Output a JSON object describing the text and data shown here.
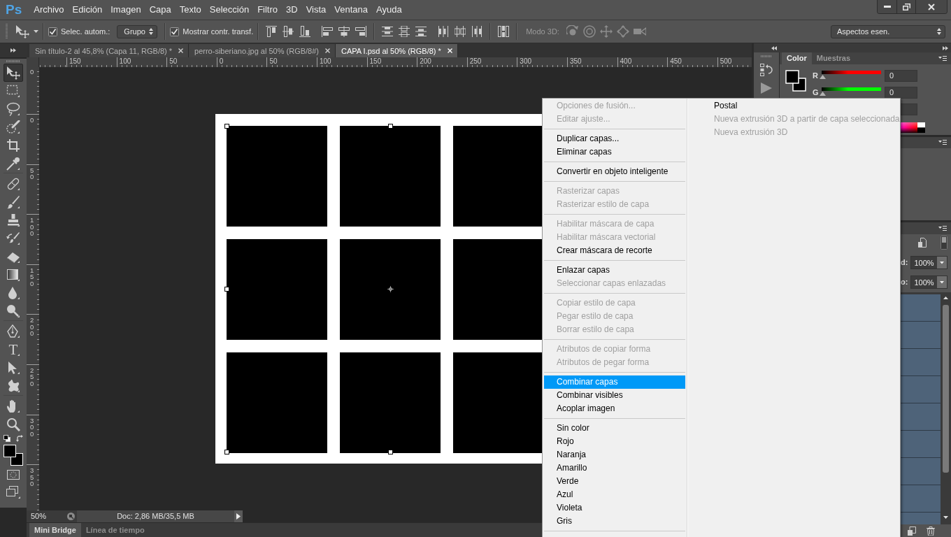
{
  "app": {
    "logo": "Ps"
  },
  "menubar": {
    "items": [
      "Archivo",
      "Edición",
      "Imagen",
      "Capa",
      "Texto",
      "Selección",
      "Filtro",
      "3D",
      "Vista",
      "Ventana",
      "Ayuda"
    ]
  },
  "options_bar": {
    "auto_select": {
      "label": "Selec. autom.:",
      "checked": true
    },
    "auto_select_target": "Grupo",
    "show_transform": {
      "label": "Mostrar contr. transf.",
      "checked": true
    },
    "mode_3d_label": "Modo 3D:",
    "workspace": "Aspectos esen."
  },
  "document_tabs": [
    {
      "label": "Sin título-2 al 45,8% (Capa 11, RGB/8) *",
      "selected": false
    },
    {
      "label": "perro-siberiano.jpg al 50% (RGB/8#)",
      "selected": false
    },
    {
      "label": "CAPA I.psd al 50% (RGB/8) *",
      "selected": true
    }
  ],
  "tool_groups": [
    {
      "tools": [
        {
          "kind": "move",
          "selected": true
        },
        {
          "kind": "marquee",
          "selected": false
        },
        {
          "kind": "lasso",
          "selected": false
        },
        {
          "kind": "quickselect",
          "selected": false
        },
        {
          "kind": "crop",
          "selected": false
        },
        {
          "kind": "eyedropper",
          "selected": false
        }
      ]
    },
    {
      "tools": [
        {
          "kind": "healing",
          "selected": false
        },
        {
          "kind": "brush",
          "selected": false
        },
        {
          "kind": "stamp",
          "selected": false
        },
        {
          "kind": "historybrush",
          "selected": false
        },
        {
          "kind": "eraser",
          "selected": false
        },
        {
          "kind": "gradient",
          "selected": false
        },
        {
          "kind": "blur",
          "selected": false
        },
        {
          "kind": "dodge",
          "selected": false
        }
      ]
    },
    {
      "tools": [
        {
          "kind": "pen",
          "selected": false
        },
        {
          "kind": "type",
          "glyph": "T",
          "selected": false
        },
        {
          "kind": "pathselect",
          "selected": false
        },
        {
          "kind": "shape",
          "selected": false
        }
      ]
    },
    {
      "tools": [
        {
          "kind": "hand",
          "selected": false
        },
        {
          "kind": "zoom",
          "selected": false
        }
      ]
    }
  ],
  "rulers": {
    "horizontal": [
      "150",
      "100",
      "50",
      "0",
      "50",
      "100",
      "150",
      "200",
      "250",
      "300",
      "350",
      "400",
      "450",
      "500"
    ],
    "vertical": [
      "0",
      "0",
      "50",
      "100",
      "150",
      "200",
      "250",
      "300",
      "350"
    ]
  },
  "status_bar": {
    "zoom": "50%",
    "doc_info": "Doc: 2,86 MB/35,5 MB"
  },
  "bottom_tabs": [
    {
      "label": "Mini Bridge",
      "selected": true
    },
    {
      "label": "Línea de tiempo",
      "selected": false
    }
  ],
  "color_panel": {
    "tabs": [
      {
        "label": "Color",
        "selected": true
      },
      {
        "label": "Muestras",
        "selected": false
      }
    ],
    "channels": [
      {
        "label": "R",
        "level": 0,
        "value": "0",
        "color": "#ff0000"
      },
      {
        "label": "G",
        "level": 0,
        "value": "0",
        "color": "#00ff00"
      }
    ]
  },
  "layers_panel": {
    "fields": [
      {
        "label": "d:",
        "value": "100%"
      },
      {
        "label": "o:",
        "value": "100%"
      }
    ]
  },
  "context_menu": {
    "groups": [
      {
        "items": [
          {
            "label": "Opciones de fusión...",
            "disabled": true,
            "selected": false
          },
          {
            "label": "Editar ajuste...",
            "disabled": true,
            "selected": false
          }
        ]
      },
      {
        "items": [
          {
            "label": "Duplicar capas...",
            "disabled": false,
            "selected": false
          },
          {
            "label": "Eliminar capas",
            "disabled": false,
            "selected": false
          }
        ]
      },
      {
        "items": [
          {
            "label": "Convertir en objeto inteligente",
            "disabled": false,
            "selected": false
          }
        ]
      },
      {
        "items": [
          {
            "label": "Rasterizar capas",
            "disabled": true,
            "selected": false
          },
          {
            "label": "Rasterizar estilo de capa",
            "disabled": true,
            "selected": false
          }
        ]
      },
      {
        "items": [
          {
            "label": "Habilitar máscara de capa",
            "disabled": true,
            "selected": false
          },
          {
            "label": "Habilitar máscara vectorial",
            "disabled": true,
            "selected": false
          },
          {
            "label": "Crear máscara de recorte",
            "disabled": false,
            "selected": false
          }
        ]
      },
      {
        "items": [
          {
            "label": "Enlazar capas",
            "disabled": false,
            "selected": false
          },
          {
            "label": "Seleccionar capas enlazadas",
            "disabled": true,
            "selected": false
          }
        ]
      },
      {
        "items": [
          {
            "label": "Copiar estilo de capa",
            "disabled": true,
            "selected": false
          },
          {
            "label": "Pegar estilo de capa",
            "disabled": true,
            "selected": false
          },
          {
            "label": "Borrar estilo de capa",
            "disabled": true,
            "selected": false
          }
        ]
      },
      {
        "items": [
          {
            "label": "Atributos de copiar forma",
            "disabled": true,
            "selected": false
          },
          {
            "label": "Atributos de pegar forma",
            "disabled": true,
            "selected": false
          }
        ]
      },
      {
        "items": [
          {
            "label": "Combinar capas",
            "disabled": false,
            "selected": true
          },
          {
            "label": "Combinar visibles",
            "disabled": false,
            "selected": false
          },
          {
            "label": "Acoplar imagen",
            "disabled": false,
            "selected": false
          }
        ]
      },
      {
        "items": [
          {
            "label": "Sin color",
            "disabled": false,
            "selected": false
          },
          {
            "label": "Rojo",
            "disabled": false,
            "selected": false
          },
          {
            "label": "Naranja",
            "disabled": false,
            "selected": false
          },
          {
            "label": "Amarillo",
            "disabled": false,
            "selected": false
          },
          {
            "label": "Verde",
            "disabled": false,
            "selected": false
          },
          {
            "label": "Azul",
            "disabled": false,
            "selected": false
          },
          {
            "label": "Violeta",
            "disabled": false,
            "selected": false
          },
          {
            "label": "Gris",
            "disabled": false,
            "selected": false
          }
        ]
      }
    ],
    "column_2": {
      "items": [
        {
          "label": "Postal",
          "disabled": false,
          "selected": false
        },
        {
          "label": "Nueva extrusión 3D a partir de capa seleccionada",
          "disabled": true,
          "selected": false
        },
        {
          "label": "Nueva extrusión 3D",
          "disabled": true,
          "selected": false
        }
      ]
    }
  }
}
